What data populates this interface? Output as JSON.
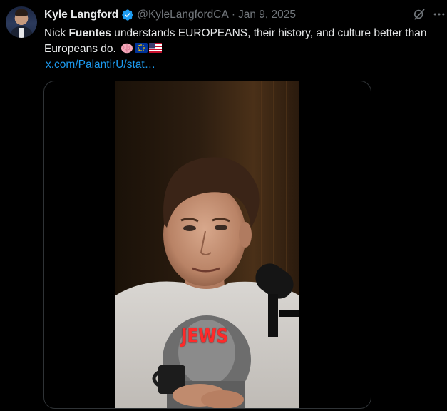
{
  "author": {
    "display_name": "Kyle Langford",
    "handle": "@KyleLangfordCA",
    "separator": "·",
    "date": "Jan 9, 2025",
    "verified": true,
    "verified_color": "#1d9bf0"
  },
  "tweet": {
    "text_prefix": "Nick ",
    "text_bold": "Fuentes",
    "text_suffix": " understands EUROPEANS, their history, and culture better than Europeans do.",
    "emojis": [
      "brain-emoji",
      "eu-flag-emoji",
      "us-flag-emoji"
    ],
    "link_text": "x.com/PalantirU/stat…"
  },
  "media": {
    "type": "video",
    "overlay_text": "JEWS",
    "overlay_color": "#ff2a2a"
  },
  "icons": {
    "grok": "grok-icon",
    "more": "more-options-icon"
  },
  "colors": {
    "background": "#000000",
    "text": "#e7e9ea",
    "secondary": "#71767b",
    "link": "#1d9bf0",
    "border": "#2f3336"
  }
}
